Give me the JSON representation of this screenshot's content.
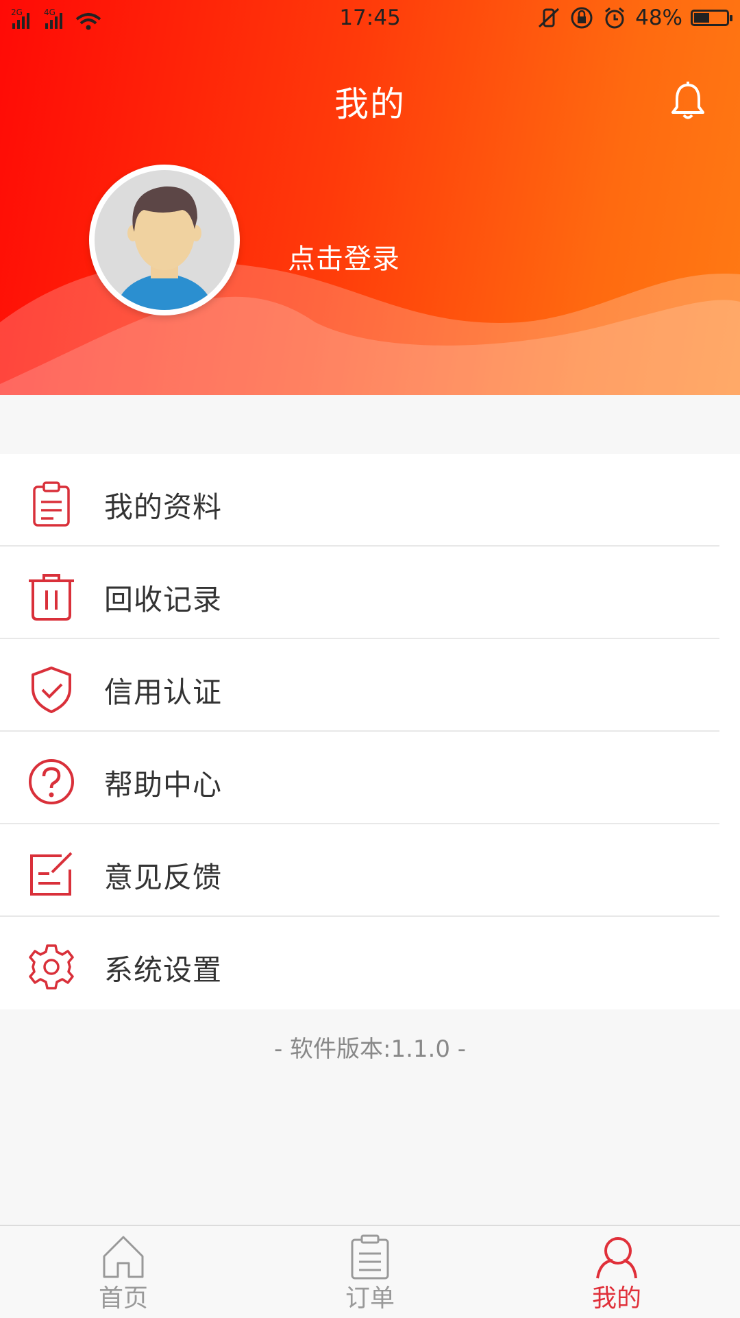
{
  "status_bar": {
    "network_left": "2G",
    "network_right": "4G",
    "time": "17:45",
    "battery": "48%",
    "battery_level": 0.48
  },
  "header": {
    "title": "我的",
    "login_prompt": "点击登录"
  },
  "menu": {
    "items": [
      {
        "label": "我的资料",
        "icon": "clipboard-icon"
      },
      {
        "label": "回收记录",
        "icon": "trash-icon"
      },
      {
        "label": "信用认证",
        "icon": "shield-check-icon"
      },
      {
        "label": "帮助中心",
        "icon": "help-circle-icon"
      },
      {
        "label": "意见反馈",
        "icon": "feedback-edit-icon"
      },
      {
        "label": "系统设置",
        "icon": "gear-icon"
      }
    ]
  },
  "version_text": "- 软件版本:1.1.0 -",
  "tabbar": {
    "tabs": [
      {
        "label": "首页",
        "icon": "home-icon"
      },
      {
        "label": "订单",
        "icon": "order-list-icon"
      },
      {
        "label": "我的",
        "icon": "profile-icon",
        "active": true
      }
    ]
  },
  "colors": {
    "accent": "#e0303a",
    "header_start": "#ff0a06",
    "header_end": "#ff7a14"
  }
}
